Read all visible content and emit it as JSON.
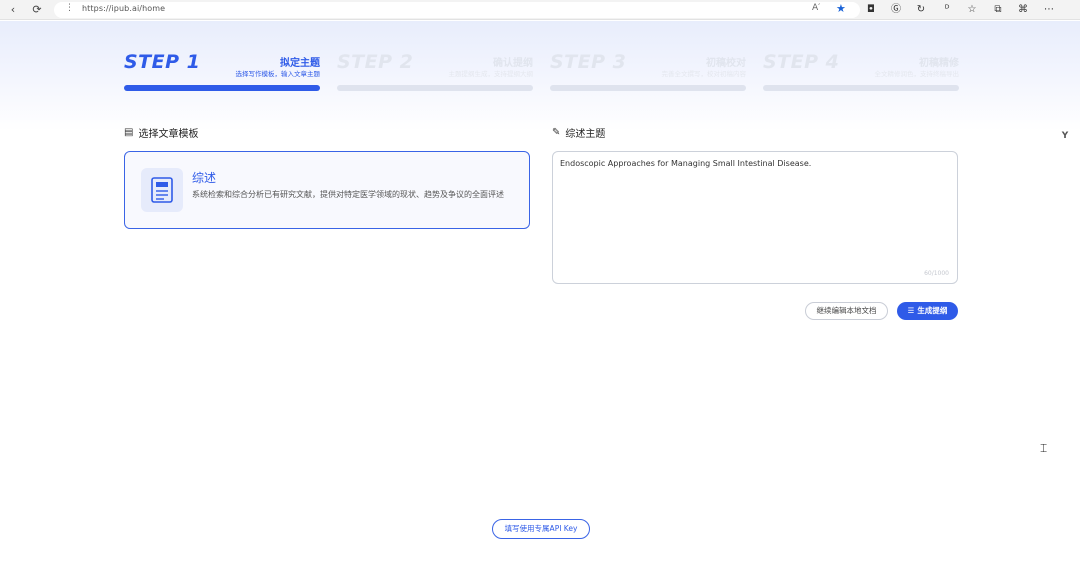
{
  "browser": {
    "url": "https://ipub.ai/home",
    "back_icon": "arrow-left-icon",
    "reload_icon": "reload-icon"
  },
  "steps": [
    {
      "num": "STEP 1",
      "title": "拟定主题",
      "desc": "选择写作模板，输入文章主题",
      "active": true
    },
    {
      "num": "STEP 2",
      "title": "确认提纲",
      "desc": "主题提纲生成，支持提纲大纲",
      "active": false
    },
    {
      "num": "STEP 3",
      "title": "初稿校对",
      "desc": "完善全文撰写，校对初稿内容",
      "active": false
    },
    {
      "num": "STEP 4",
      "title": "初稿精修",
      "desc": "全文精修润色，支持终稿导出",
      "active": false
    }
  ],
  "template_section": {
    "title": "选择文章模板",
    "card": {
      "name": "综述",
      "icon_label": "综述",
      "description": "系统检索和综合分析已有研究文献，提供对特定医学领域的现状、趋势及争议的全面评述"
    }
  },
  "topic_section": {
    "title": "综述主题",
    "value": "Endoscopic Approaches for Managing Small Intestinal Disease.",
    "char_count": "60/1000"
  },
  "actions": {
    "continue_label": "继续编辑本地文档",
    "generate_label": "生成提纲"
  },
  "api_key_label": "填写使用专属API Key",
  "colors": {
    "accent": "#2f5be8",
    "inactive": "#e1e5ee"
  }
}
